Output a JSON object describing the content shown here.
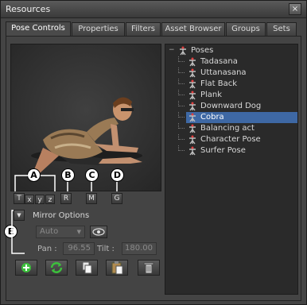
{
  "window": {
    "title": "Resources",
    "close_symbol": "×"
  },
  "tabs": [
    {
      "label": "Pose Controls",
      "active": true
    },
    {
      "label": "Properties",
      "active": false
    },
    {
      "label": "Filters",
      "active": false
    },
    {
      "label": "Asset Browser",
      "active": false
    },
    {
      "label": "Groups",
      "active": false
    },
    {
      "label": "Sets",
      "active": false
    }
  ],
  "transform_buttons": {
    "t": "T",
    "x": "x",
    "y": "y",
    "z": "z",
    "r": "R",
    "m": "M",
    "g": "G"
  },
  "callouts": {
    "a": "A",
    "b": "B",
    "c": "C",
    "d": "D",
    "e": "E"
  },
  "mirror": {
    "label": "Mirror Options",
    "dropdown_value": "Auto"
  },
  "pan": {
    "label": "Pan :",
    "value": "96.55"
  },
  "tilt": {
    "label": "Tilt :",
    "value": "180.00"
  },
  "tree": {
    "root": "Poses",
    "items": [
      "Tadasana",
      "Uttanasana",
      "Flat Back",
      "Plank",
      "Downward Dog",
      "Cobra",
      "Balancing act",
      "Character Pose",
      "Surfer Pose"
    ],
    "selected": "Cobra"
  },
  "colors": {
    "selection": "#3e68a4",
    "add_green": "#3cbf3c"
  },
  "icons": {
    "toolbar": [
      "add-icon",
      "refresh-icon",
      "copy-icon",
      "paste-icon",
      "trash-icon"
    ]
  }
}
